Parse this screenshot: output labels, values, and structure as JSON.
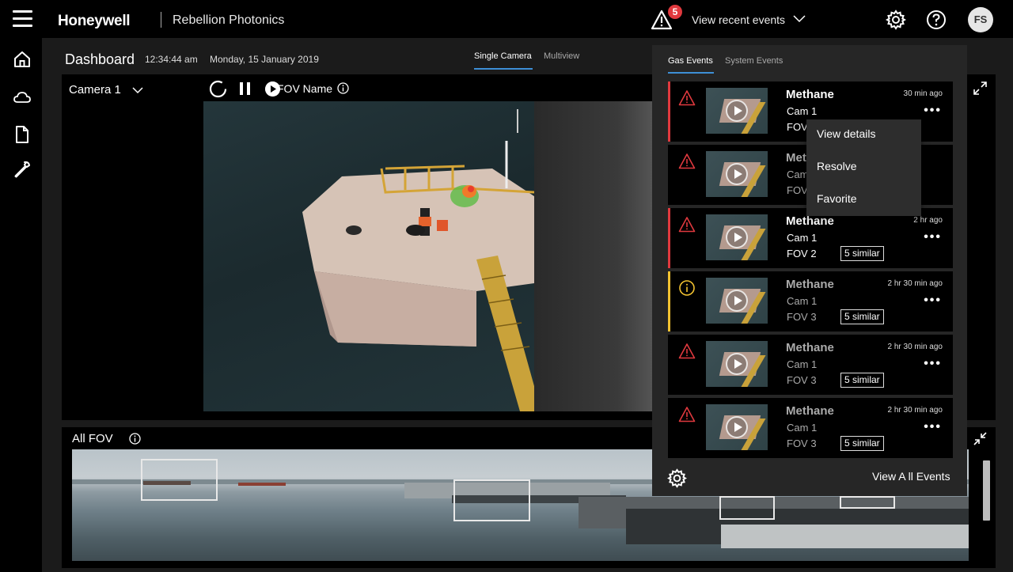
{
  "topbar": {
    "brand": "Honeywell",
    "product": "Rebellion Photonics",
    "alert_count": "5",
    "recent_events_label": "View recent events",
    "avatar_initials": "FS",
    "badge_color": "#e0393e"
  },
  "leftnav": {
    "icons": [
      "home-icon",
      "cloud-icon",
      "document-icon",
      "wrench-icon"
    ]
  },
  "dashboard": {
    "title": "Dashboard",
    "time": "12:34:44 am",
    "date": "Monday, 15 January 2019",
    "view_tabs": [
      "Single Camera",
      "Multiview"
    ],
    "active_view": "Single Camera"
  },
  "camera": {
    "selected": "Camera 1",
    "fov_name": "FOV Name"
  },
  "all_fov": {
    "label": "All FOV"
  },
  "events_panel": {
    "tabs": [
      "Gas Events",
      "System Events"
    ],
    "active_tab": "Gas Events",
    "events": [
      {
        "title": "Methane",
        "cam": "Cam 1",
        "fov": "FOV",
        "time": "30 min ago",
        "level": "alarm",
        "similar": ""
      },
      {
        "title": "Methane",
        "cam": "Cam 1",
        "fov": "FOV",
        "time": "",
        "level": "alarm",
        "similar": ""
      },
      {
        "title": "Methane",
        "cam": "Cam 1",
        "fov": "FOV 2",
        "time": "2 hr ago",
        "level": "alarm",
        "similar": "5 similar"
      },
      {
        "title": "Methane",
        "cam": "Cam 1",
        "fov": "FOV 3",
        "time": "2 hr 30 min ago",
        "level": "warning",
        "similar": "5 similar"
      },
      {
        "title": "Methane",
        "cam": "Cam 1",
        "fov": "FOV 3",
        "time": "2 hr 30 min ago",
        "level": "alarm",
        "similar": "5 similar"
      },
      {
        "title": "Methane",
        "cam": "Cam 1",
        "fov": "FOV 3",
        "time": "2 hr 30 min ago",
        "level": "alarm",
        "similar": "5 similar"
      }
    ],
    "view_all_label": "View A ll Events",
    "alarm_color": "#e0393e",
    "warning_color": "#f2c230"
  },
  "context_menu": {
    "items": [
      "View details",
      "Resolve",
      "Favorite"
    ]
  }
}
